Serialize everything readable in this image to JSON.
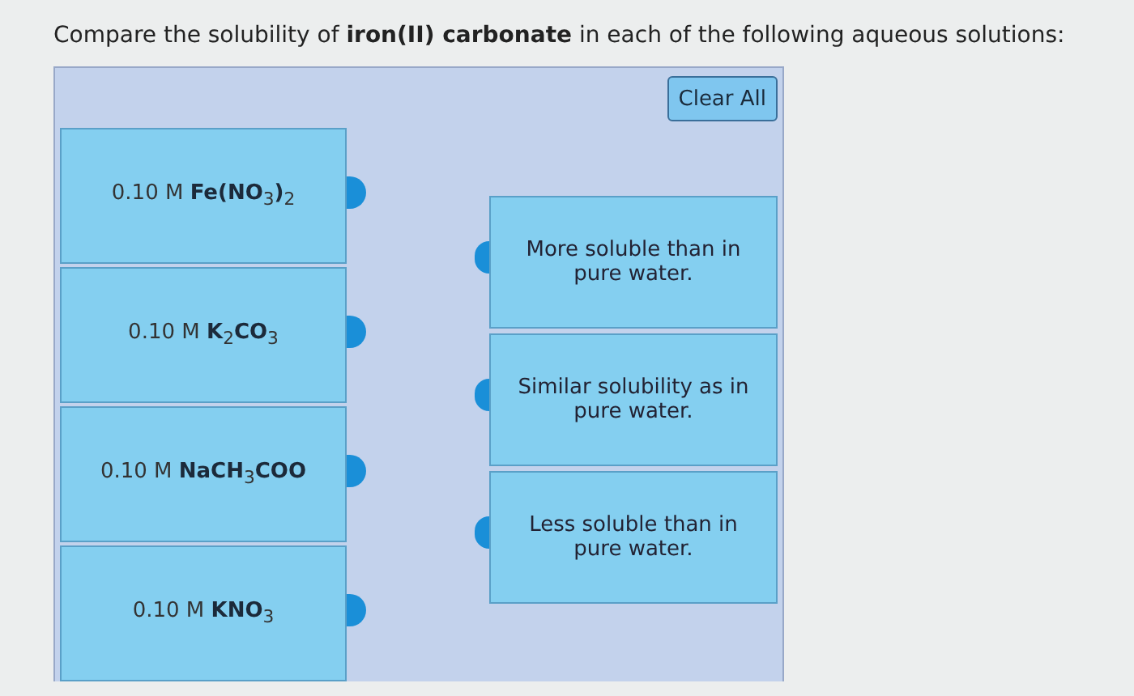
{
  "prompt": "Compare the solubility of **iron(II) carbonate** in each of the following aqueous solutions:",
  "clear_button": "Clear All",
  "solutions": [
    {
      "label": "0.10 M **Fe(NO**$_{3}$**)**$_{2}$"
    },
    {
      "label": "0.10 M **K**$_{2}$**CO**$_{3}$"
    },
    {
      "label": "0.10 M **NaCH**$_{3}$**COO**"
    },
    {
      "label": "0.10 M **KNO**$_{3}$"
    }
  ],
  "categories": [
    {
      "label": "More soluble than in pure water."
    },
    {
      "label": "Similar solubility as in pure water."
    },
    {
      "label": "Less soluble than in pure water."
    }
  ]
}
